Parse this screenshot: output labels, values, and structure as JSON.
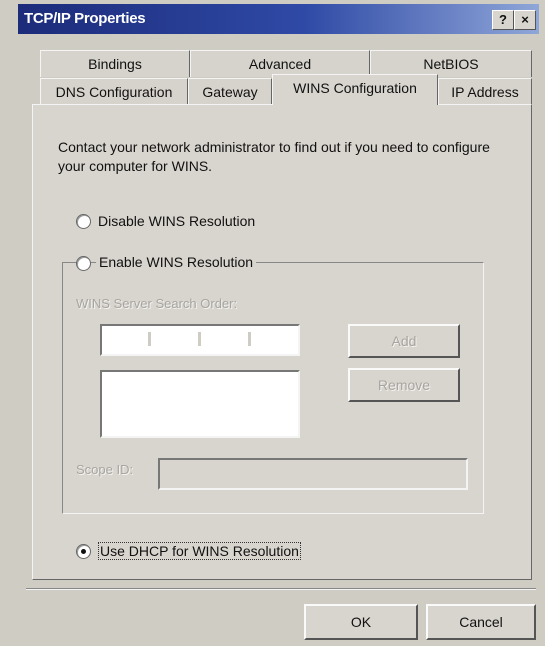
{
  "window": {
    "title": "TCP/IP Properties",
    "help_label": "?",
    "close_label": "×"
  },
  "tabs_back": [
    {
      "label": "Bindings"
    },
    {
      "label": "Advanced"
    },
    {
      "label": "NetBIOS"
    }
  ],
  "tabs_front": [
    {
      "label": "DNS Configuration"
    },
    {
      "label": "Gateway"
    },
    {
      "label": "WINS Configuration"
    },
    {
      "label": "IP Address"
    }
  ],
  "description": "Contact your network administrator to find out if you need to configure your computer for WINS.",
  "options": {
    "disable": {
      "label": "Disable WINS Resolution",
      "selected": false
    },
    "enable": {
      "label": "Enable WINS Resolution",
      "selected": false
    },
    "dhcp": {
      "label": "Use DHCP for WINS Resolution",
      "selected": true
    }
  },
  "wins": {
    "search_order_label": "WINS Server Search Order:",
    "add_label": "Add",
    "remove_label": "Remove",
    "scope_label": "Scope ID:"
  },
  "footer": {
    "ok_label": "OK",
    "cancel_label": "Cancel"
  }
}
